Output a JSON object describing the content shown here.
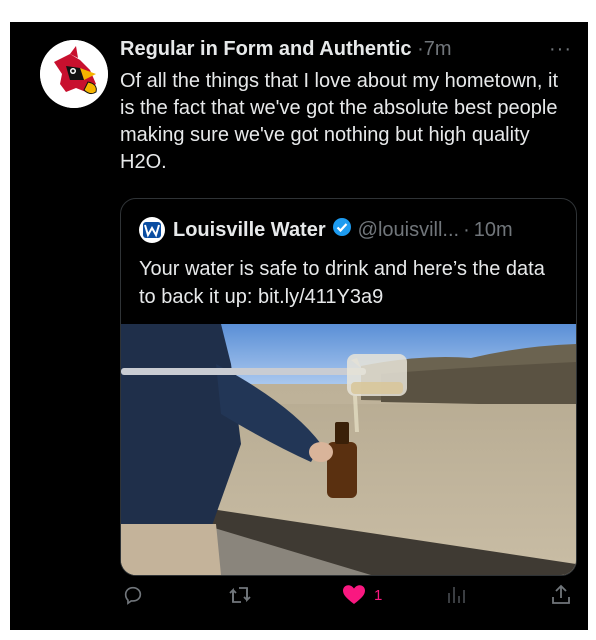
{
  "tweet": {
    "author_name": "Regular in Form and Authentic",
    "separator": "·",
    "time": "7m",
    "more_label": "···",
    "text": "Of all the things that I love about my hometown, it is the fact that we've got the absolute best people making sure we've got nothing but high quality H2O."
  },
  "quote": {
    "author_name": "Louisville Water",
    "handle": "@louisvill...",
    "separator": "·",
    "time": "10m",
    "text": "Your water is safe to drink and here’s the data to back it up: bit.ly/411Y3a9"
  },
  "actions": {
    "reply_icon": "reply-icon",
    "retweet_icon": "retweet-icon",
    "like_icon": "heart-icon",
    "like_count": "1",
    "views_icon": "views-icon",
    "share_icon": "share-icon"
  },
  "colors": {
    "background": "#000000",
    "text": "#e7e9ea",
    "secondary": "#71767b",
    "like": "#f91880",
    "verified": "#1d9bf0",
    "border": "#2f3336"
  }
}
